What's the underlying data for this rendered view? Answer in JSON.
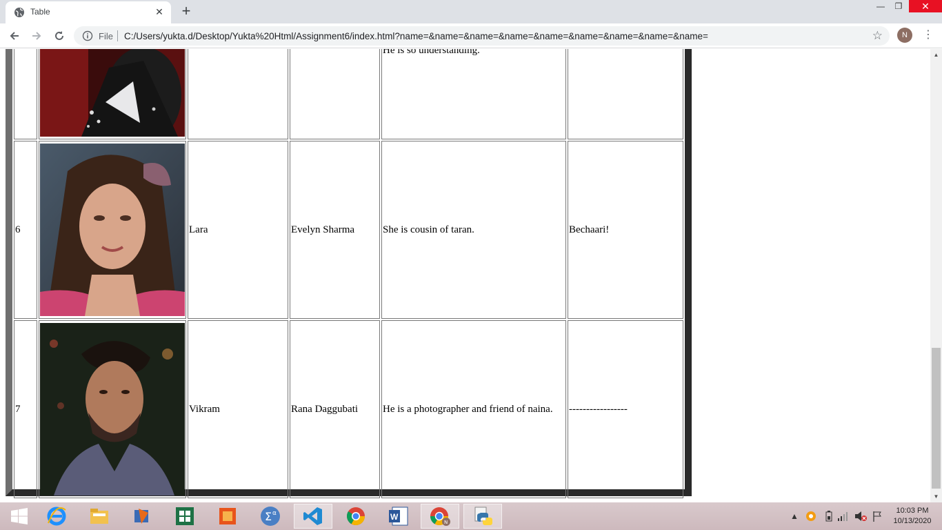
{
  "browser": {
    "tab_title": "Table",
    "file_label": "File",
    "url": "C:/Users/yukta.d/Desktop/Yukta%20Html/Assignment6/index.html?name=&name=&name=&name=&name=&name=&name=&name=&name=",
    "profile_initial": "N"
  },
  "table": {
    "partial_row": {
      "description": "He is so understanding."
    },
    "rows": [
      {
        "number": "6",
        "role": "Lara",
        "actor": "Evelyn Sharma",
        "description": "She is cousin of taran.",
        "note": "Bechaari!"
      },
      {
        "number": "7",
        "role": "Vikram",
        "actor": "Rana Daggubati",
        "description": "He is a photographer and friend of naina.",
        "note": "-----------------"
      }
    ]
  },
  "taskbar": {
    "time": "10:03 PM",
    "date": "10/13/2020",
    "apps": [
      "windows-start",
      "internet-explorer",
      "file-explorer",
      "media-app",
      "excel",
      "office-app",
      "math-input-panel",
      "vscode",
      "chrome",
      "word",
      "chrome-profile",
      "python"
    ]
  },
  "colors": {
    "tab_strip": "#dee1e6",
    "close_red": "#e81123",
    "table_border_dark": "#2a2a2a",
    "table_border_light": "#6f6f6f"
  }
}
